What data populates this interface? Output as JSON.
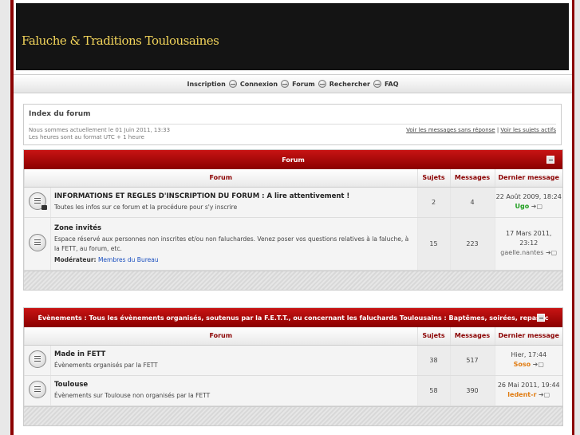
{
  "header": {
    "site_title": "Faluche & Traditions Toulousaines"
  },
  "nav": {
    "items": [
      "Inscription",
      "Connexion",
      "Forum",
      "Rechercher",
      "FAQ"
    ]
  },
  "info": {
    "breadcrumb": "Index du forum",
    "current_time": "Nous sommes actuellement le 01 Juin 2011, 13:33",
    "timezone": "Les heures sont au format UTC + 1 heure",
    "link_unanswered": "Voir les messages sans réponse",
    "link_separator": " | ",
    "link_active": "Voir les sujets actifs"
  },
  "columns": {
    "forum": "Forum",
    "topics": "Sujets",
    "posts": "Messages",
    "last_post": "Dernier message"
  },
  "categories": [
    {
      "title": "Forum",
      "forums": [
        {
          "title": "INFORMATIONS ET REGLES D'INSCRIPTION DU FORUM : A lire attentivement !",
          "desc": "Toutes les infos sur ce forum et la procédure pour s'y inscrire",
          "topics": "2",
          "posts": "4",
          "last_date": "22 Août 2009, 18:24",
          "last_user": "Ugo"
        },
        {
          "title": "Zone invités",
          "desc": "Espace réservé aux personnes non inscrites et/ou non faluchardes. Venez poser vos questions relatives à la faluche, à la FETT, au forum, etc.",
          "mod_label": "Modérateur:",
          "mod_value": "Membres du Bureau",
          "topics": "15",
          "posts": "223",
          "last_date": "17 Mars 2011, 23:12",
          "last_user": "gaelle.nantes"
        }
      ]
    },
    {
      "title": "Évènements : Tous les évènements organisés, soutenus par la F.E.T.T., ou concernant les faluchards Toulousains : Baptêmes, soirées, repas, congrè",
      "forums": [
        {
          "title": "Made in FETT",
          "desc": "Évènements organisés par la FETT",
          "topics": "38",
          "posts": "517",
          "last_date": "Hier, 17:44",
          "last_user": "Soso"
        },
        {
          "title": "Toulouse",
          "desc": "Évènements sur Toulouse non organisés par la FETT",
          "topics": "58",
          "posts": "390",
          "last_date": "26 Mai 2011, 19:44",
          "last_user": "ledent-r"
        }
      ]
    }
  ],
  "icons": {
    "forum_read": "forum-read-icon",
    "forum_locked": "forum-locked-icon",
    "goto_last": "goto-last-post-icon"
  },
  "colors": {
    "accent": "#8a0000",
    "user_admin": "#1e9e1e",
    "user_mod": "#e07b10",
    "link": "#1a4fbf"
  }
}
